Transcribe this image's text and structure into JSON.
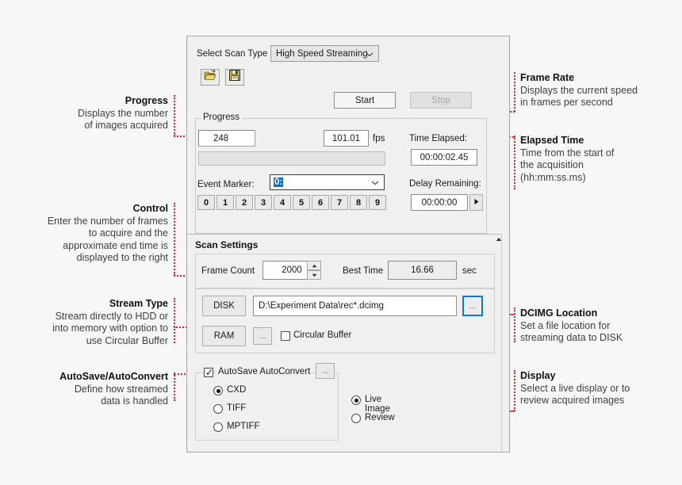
{
  "app": {
    "scan_type_label": "Select Scan Type",
    "scan_type_value": "High Speed Streaming",
    "toolbar": {
      "open_icon": "open-folder-icon",
      "save_icon": "save-floppy-icon"
    },
    "start_label": "Start",
    "stop_label": "Stop",
    "progress": {
      "group_label": "Progress",
      "images_acquired": "248",
      "fps_value": "101.01",
      "fps_unit": "fps",
      "progress_percent": 0,
      "event_marker_label": "Event Marker:",
      "event_marker_value": "0:",
      "number_buttons": [
        "0",
        "1",
        "2",
        "3",
        "4",
        "5",
        "6",
        "7",
        "8",
        "9"
      ],
      "time_elapsed_label": "Time Elapsed:",
      "time_elapsed_value": "00:00:02.45",
      "delay_remaining_label": "Delay Remaining:",
      "delay_remaining_value": "00:00:00",
      "delay_play_icon": "play-arrow-icon"
    },
    "scan_settings": {
      "title": "Scan Settings",
      "scroll_up_icon": "scroll-up-icon",
      "frame_count_label": "Frame Count",
      "frame_count_value": "2000",
      "spinner_up_icon": "spinner-up-icon",
      "spinner_down_icon": "spinner-down-icon",
      "best_time_label": "Best Time",
      "best_time_value": "16.66",
      "best_time_unit": "sec",
      "disk_label": "DISK",
      "disk_path": "D:\\Experiment Data\\rec*.dcimg",
      "disk_browse_label": "...",
      "ram_label": "RAM",
      "ram_browse_label": "...",
      "circular_buffer_label": "Circular Buffer",
      "circular_buffer_checked": false
    },
    "autosave": {
      "checkbox_label": "AutoSave AutoConvert",
      "checked": true,
      "options_label": "...",
      "formats": [
        {
          "label": "CXD",
          "selected": true
        },
        {
          "label": "TIFF",
          "selected": false
        },
        {
          "label": "MPTIFF",
          "selected": false
        }
      ]
    },
    "display": {
      "options": [
        {
          "label": "Live Image",
          "selected": true
        },
        {
          "label": "Review",
          "selected": false
        }
      ]
    }
  },
  "annotations": {
    "left": [
      {
        "title": "Progress",
        "body": "Displays the number\nof images acquired"
      },
      {
        "title": "Control",
        "body": "Enter the number of frames\nto acquire and the\napproximate end time is\ndisplayed to the right"
      },
      {
        "title": "Stream Type",
        "body": "Stream directly to HDD or\ninto memory with option to\nuse Circular Buffer"
      },
      {
        "title": "AutoSave/AutoConvert",
        "body": "Define how streamed\ndata is handled"
      }
    ],
    "right": [
      {
        "title": "Frame Rate",
        "body": "Displays the current speed\nin frames per second"
      },
      {
        "title": "Elapsed Time",
        "body": "Time from the start of\nthe acquisition\n(hh:mm:ss.ms)"
      },
      {
        "title": "DCIMG Location",
        "body": "Set a file location for\nstreaming data to DISK"
      },
      {
        "title": "Display",
        "body": "Select a live display or to\nreview acquired images"
      }
    ],
    "leader_color": "#ee1c25"
  }
}
